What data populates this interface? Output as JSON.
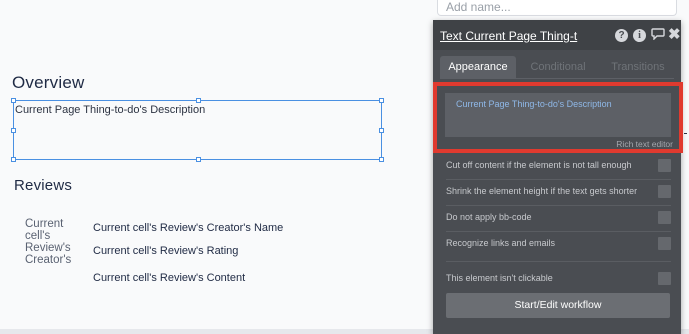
{
  "canvas": {
    "add_name_placeholder": "Add name...",
    "overview_heading": "Overview",
    "selected_text": "Current Page Thing-to-do's Description",
    "reviews_heading": "Reviews",
    "creator_lines": [
      "Current",
      "cell's",
      "Review's",
      "Creator's"
    ],
    "review_fields": [
      "Current cell's Review's Creator's Name",
      "Current cell's Review's Rating",
      "Current cell's Review's Content"
    ]
  },
  "panel": {
    "title": "Text Current Page Thing-t",
    "header_icons": [
      "help-icon",
      "info-icon",
      "comment-icon",
      "close-icon"
    ],
    "help_glyph": "?",
    "info_glyph": "i",
    "close_glyph": "✖",
    "tabs": [
      {
        "label": "Appearance",
        "active": true
      },
      {
        "label": "Conditional",
        "active": false
      },
      {
        "label": "Transitions",
        "active": false
      }
    ],
    "rich_text_value": "Current Page Thing-to-do's Description",
    "rich_text_hint": "Rich text editor",
    "options": [
      {
        "label": "Cut off content if the element is not tall enough",
        "checked": false
      },
      {
        "label": "Shrink the element height if the text gets shorter",
        "checked": false
      },
      {
        "label": "Do not apply bb-code",
        "checked": false
      },
      {
        "label": "Recognize links and emails",
        "checked": false
      }
    ],
    "clickable_option": {
      "label": "This element isn't clickable",
      "checked": false
    },
    "workflow_button": "Start/Edit workflow"
  },
  "colors": {
    "selection": "#4a90e2",
    "highlight_frame": "#e03a2f",
    "panel_bg": "#4a4d52",
    "link_text": "#8fb8e8"
  }
}
